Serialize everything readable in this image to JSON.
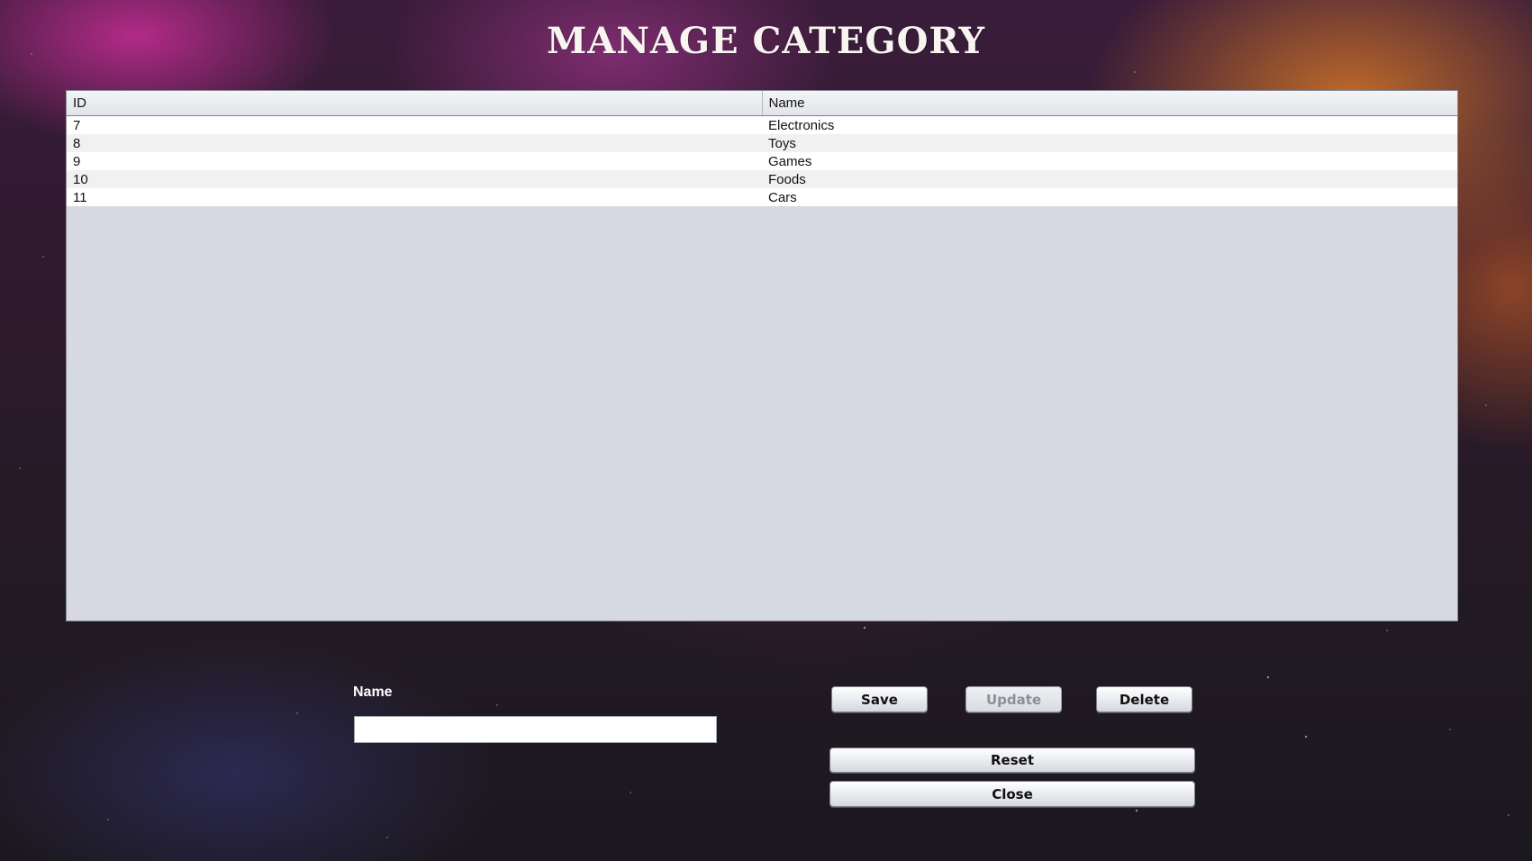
{
  "header": {
    "title": "MANAGE CATEGORY"
  },
  "table": {
    "columns": [
      "ID",
      "Name"
    ],
    "rows": [
      {
        "id": "7",
        "name": "Electronics"
      },
      {
        "id": "8",
        "name": "Toys"
      },
      {
        "id": "9",
        "name": "Games"
      },
      {
        "id": "10",
        "name": "Foods"
      },
      {
        "id": "11",
        "name": "Cars"
      }
    ]
  },
  "form": {
    "name_label": "Name",
    "name_value": "",
    "name_placeholder": ""
  },
  "buttons": {
    "save": "Save",
    "update": "Update",
    "delete": "Delete",
    "reset": "Reset",
    "close": "Close"
  },
  "colors": {
    "title_text": "#f8f4f0",
    "table_background": "#d6d9e1",
    "disabled_text": "#8e9098"
  }
}
